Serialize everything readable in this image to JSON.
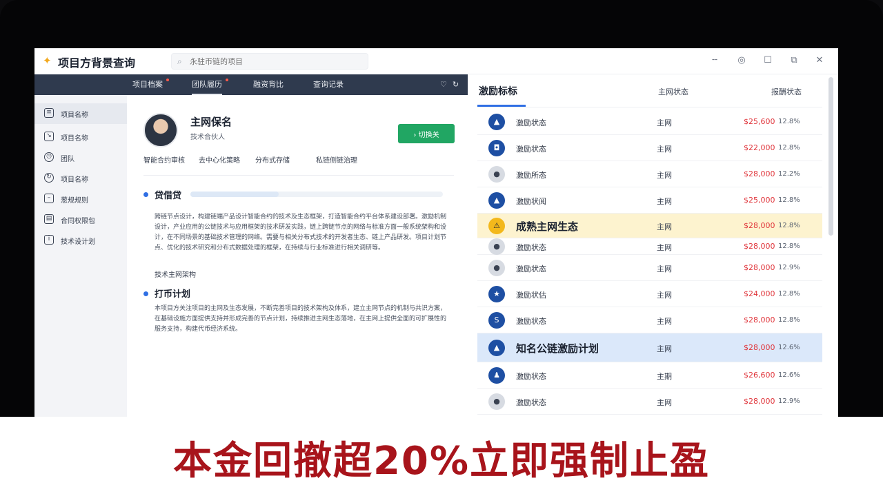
{
  "app": {
    "title": "项目方背景查询",
    "search_placeholder": "永驻币链的项目"
  },
  "window_controls": [
    "minimize-icon",
    "info-icon",
    "edit-icon",
    "share-icon",
    "close-icon"
  ],
  "nav": {
    "tabs": [
      {
        "label": "项目档案",
        "dot": true
      },
      {
        "label": "团队履历",
        "dot": true,
        "active": true
      },
      {
        "label": "融资背比",
        "dot": false
      },
      {
        "label": "查询记录",
        "dot": false
      }
    ]
  },
  "sidebar": {
    "items": [
      {
        "label": "项目名称",
        "active": true,
        "icon": "list-icon"
      },
      {
        "label": "项目名称",
        "icon": "doc-icon"
      },
      {
        "label": "团队",
        "icon": "clock-icon"
      },
      {
        "label": "项目名称",
        "icon": "refresh-icon"
      },
      {
        "label": "葱规规则",
        "icon": "card-icon"
      },
      {
        "label": "合同权限包",
        "icon": "table-icon"
      },
      {
        "label": "技术设计划",
        "icon": "info-icon"
      }
    ]
  },
  "profile": {
    "name": "主网保名",
    "role": "技术合伙人",
    "follow_label": "› 切换关",
    "stats": [
      "智能合约审核",
      "去中心化策略",
      "分布式存储",
      "私链侧链治理"
    ]
  },
  "sections": {
    "first_title": "贷借贷",
    "first_progress": 0.35,
    "first_text": "跨链节点设计，构建链端产品设计智能合约的技术及生态框架，打造智能合约平台体系建设部署。激励机制设计，产业应用的公链技术与应用框架的技术研发实践，链上跨链节点的网络与标准方面一般系统架构和设计，在不同场景的基础技术管理的网络。需要与相关分布式技术的开发者生态、链上产品研发。项目计划节点、优化的技术研究和分布式数据处理的框架，在持续与行业标准进行相关调研等。",
    "subline": "技术主网架构",
    "second_title": "打币计划",
    "second_text": "本项目方关注项目的主网及生态发展，不断完善项目的技术架构及体系，建立主网节点的机制与共识方案，在基础设施方面提供支持并形成完善的节点计划，持续推进主网生态落地，在主网上提供全面的可扩展性的服务支持，构建代币经济系统。"
  },
  "right_panel": {
    "title": "激励标标",
    "col_status": "主网状态",
    "col_price": "报酬状态",
    "rows": [
      {
        "icon": "pin-icon",
        "name": "激励状态",
        "status": "主网",
        "price": "$25,600",
        "pct": "12.8%"
      },
      {
        "icon": "camera-icon",
        "name": "激励状态",
        "status": "主网",
        "price": "$22,000",
        "pct": "12.8%"
      },
      {
        "icon": "avatar-icon",
        "name": "激励所态",
        "status": "主网",
        "price": "$28,000",
        "pct": "12.2%"
      },
      {
        "icon": "mountain-icon",
        "name": "激励状阅",
        "status": "主网",
        "price": "$25,000",
        "pct": "12.8%"
      },
      {
        "icon": "warning-icon",
        "name": "成熟主网生态",
        "status": "主网",
        "price": "$28,000",
        "pct": "12.8%",
        "highlight": "yellow",
        "big": true
      },
      {
        "icon": "avatar-icon",
        "name": "激励状态",
        "status": "主网",
        "price": "$28,000",
        "pct": "12.8%"
      },
      {
        "icon": "avatar-icon",
        "name": "激励状态",
        "status": "主网",
        "price": "$28,000",
        "pct": "12.9%"
      },
      {
        "icon": "star-icon",
        "name": "激励状估",
        "status": "主网",
        "price": "$24,000",
        "pct": "12.8%"
      },
      {
        "icon": "s-coin-icon",
        "name": "激励状态",
        "status": "主网",
        "price": "$28,000",
        "pct": "12.8%"
      },
      {
        "icon": "triangle-icon",
        "name": "知名公链激励计划",
        "status": "主网",
        "price": "$28,000",
        "pct": "12.6%",
        "highlight": "blue",
        "big": true
      },
      {
        "icon": "bell-icon",
        "name": "激励状态",
        "status": "主期",
        "price": "$26,600",
        "pct": "12.6%"
      },
      {
        "icon": "avatar-icon",
        "name": "激励状态",
        "status": "主网",
        "price": "$28,000",
        "pct": "12.9%"
      }
    ]
  },
  "caption": "本金回撤超20%立即强制止盈",
  "colors": {
    "nav_bg": "#2f3a4e",
    "accent_blue": "#2f6fe4",
    "follow_green": "#21a663",
    "price_red": "#e0343a",
    "caption_red": "#a8141b"
  }
}
